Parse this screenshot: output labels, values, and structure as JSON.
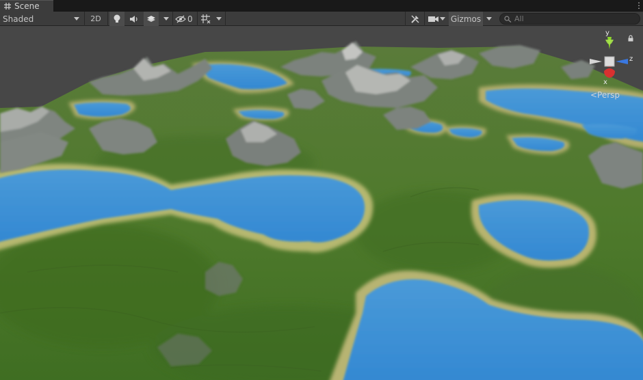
{
  "tab": {
    "title": "Scene",
    "icon": "grid-icon"
  },
  "toolbar": {
    "shading_mode": "Shaded",
    "mode_2d_label": "2D",
    "hidden_count": "0",
    "gizmos_label": "Gizmos",
    "search_placeholder": "All"
  },
  "orientation_gizmo": {
    "y_label": "y",
    "z_label": "z",
    "x_label": "x",
    "projection_label": "<Persp"
  },
  "colors": {
    "panel_bg": "#3c3c3c",
    "tab_bg": "#191919",
    "x_axis": "#d83030",
    "y_axis": "#8cd82a",
    "z_axis": "#3a78e0",
    "water": "#3d8fd6",
    "grass": "#4e7a2c",
    "rock": "#8d9190"
  }
}
